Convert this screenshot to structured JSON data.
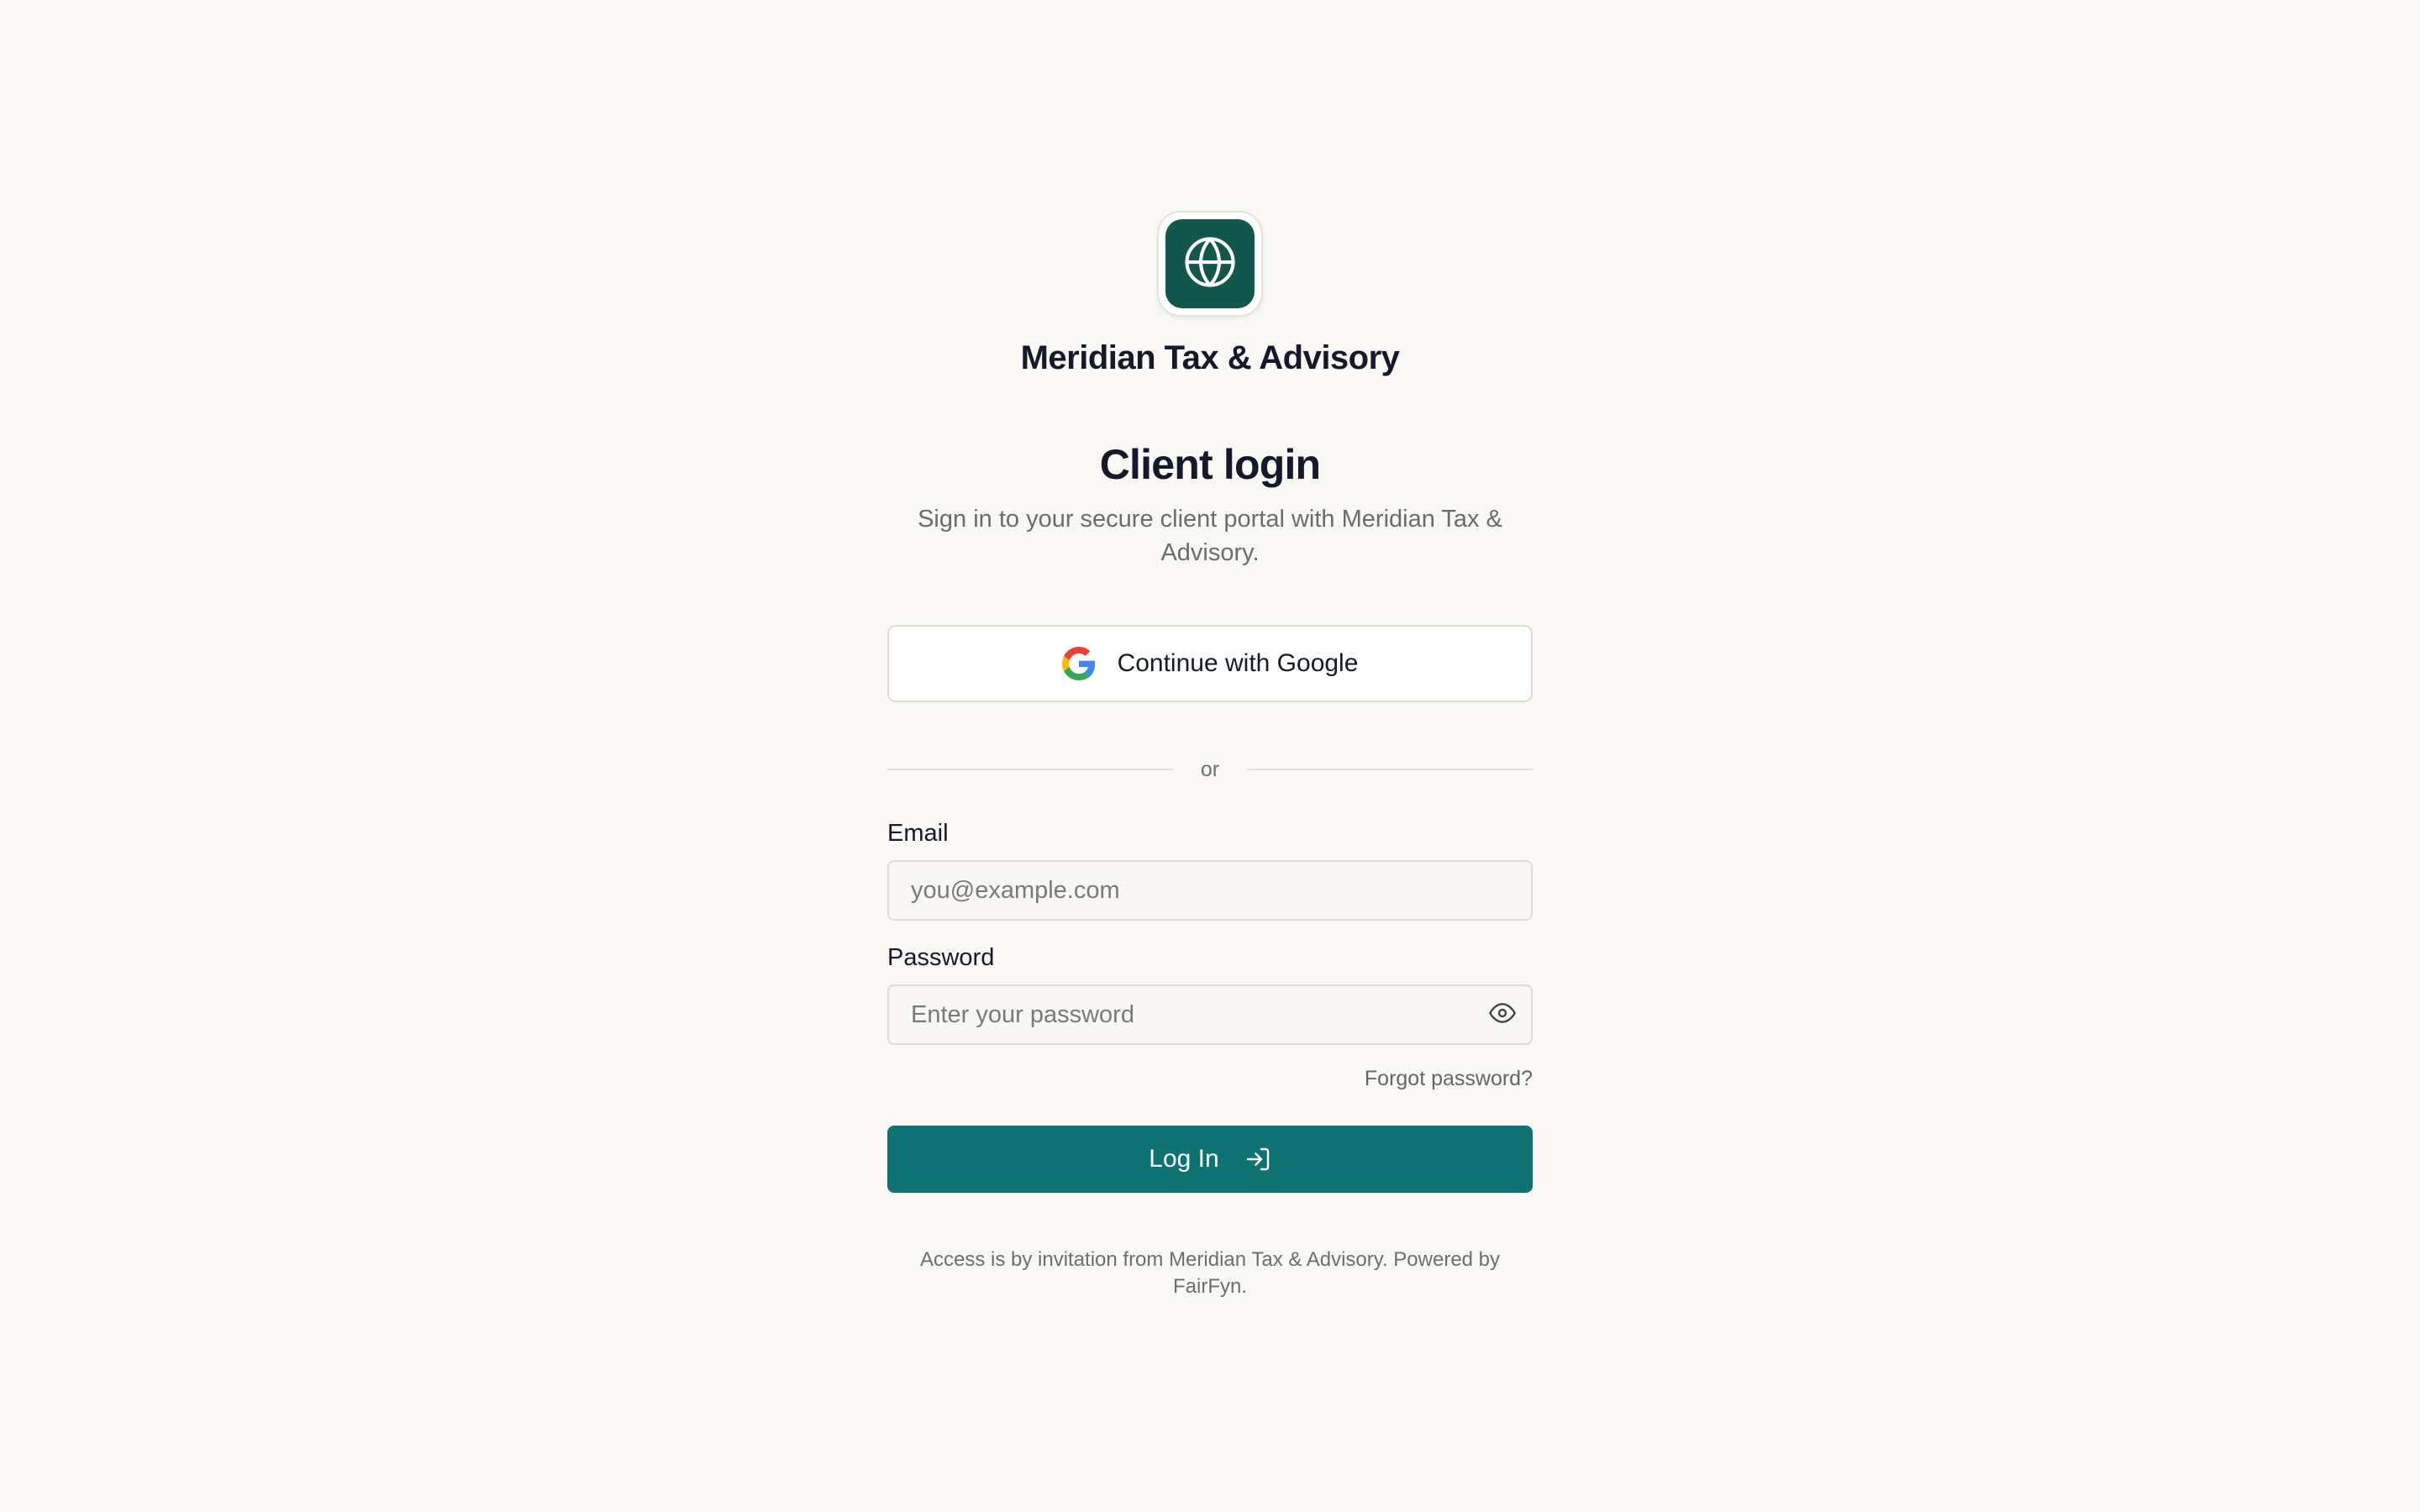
{
  "brand": {
    "firm_name": "Meridian Tax & Advisory",
    "logo_icon": "globe-icon",
    "logo_color": "#11574d"
  },
  "login": {
    "title": "Client login",
    "subtitle": "Sign in to your secure client portal with Meridian Tax & Advisory.",
    "google_button_label": "Continue with Google",
    "google_icon": "google-icon",
    "divider_text": "or",
    "email_label": "Email",
    "email_placeholder": "you@example.com",
    "email_value": "",
    "password_label": "Password",
    "password_placeholder": "Enter your password",
    "password_value": "",
    "password_toggle_icon": "eye-icon",
    "forgot_password": "Forgot password?",
    "login_button_label": "Log In",
    "login_button_icon": "log-in-arrow-icon",
    "login_button_color": "#0f7374"
  },
  "footer": {
    "text": "Access is by invitation from Meridian Tax & Advisory. Powered by FairFyn."
  },
  "colors": {
    "background": "#f9f8f4",
    "text_primary": "#16192b",
    "text_muted": "#6c6c6c"
  }
}
